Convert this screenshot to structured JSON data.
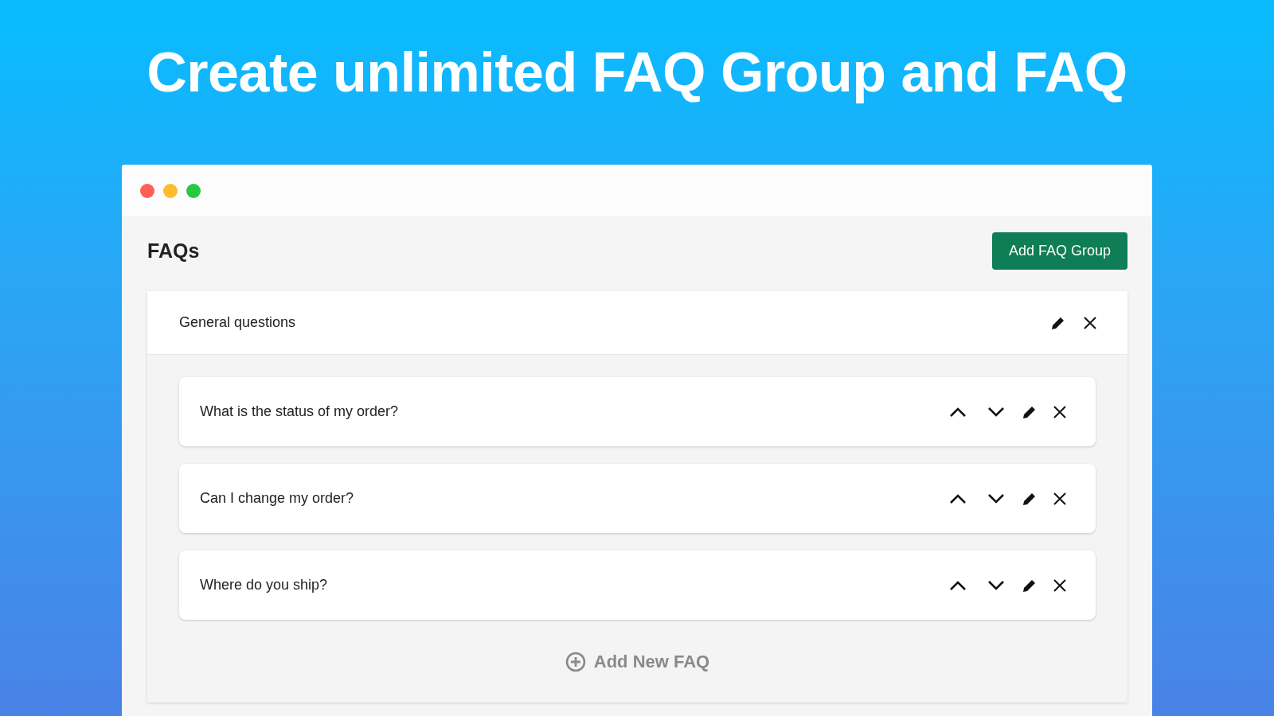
{
  "headline": "Create unlimited FAQ Group and FAQ",
  "window": {
    "controls": [
      {
        "color": "#fe5f57"
      },
      {
        "color": "#febc2e"
      },
      {
        "color": "#28c840"
      }
    ]
  },
  "page": {
    "title": "FAQs",
    "add_group_button": "Add FAQ Group"
  },
  "group": {
    "name": "General questions",
    "faqs": [
      {
        "question": "What is the status of my order?"
      },
      {
        "question": "Can I change my order?"
      },
      {
        "question": "Where do you ship?"
      }
    ],
    "add_faq_link": "Add New FAQ"
  }
}
